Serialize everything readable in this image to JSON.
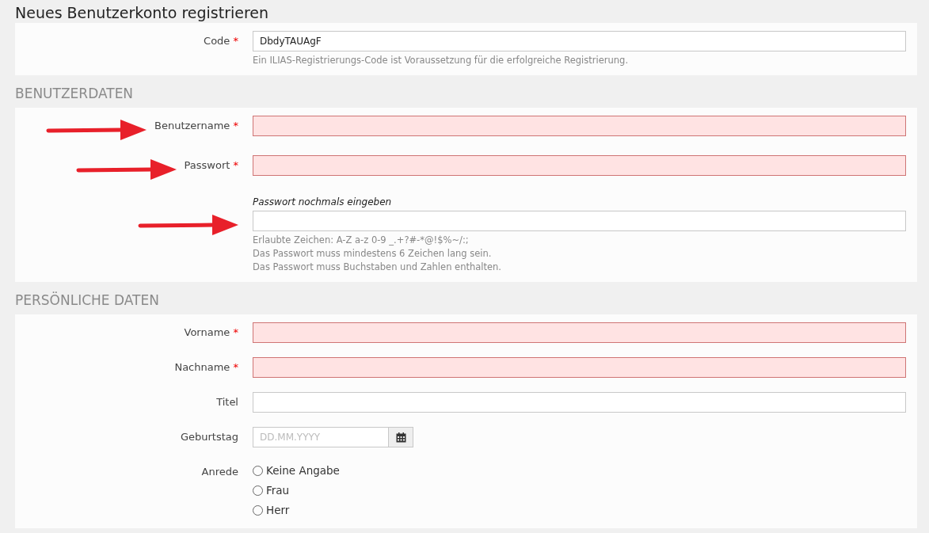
{
  "title": "Neues Benutzerkonto registrieren",
  "sections": [
    {
      "fields": [
        {
          "kind": "text",
          "label": "Code",
          "required_mark": "*",
          "invalid": false,
          "arrow": false,
          "value": "DbdyTAUAgF",
          "help": [
            "Ein ILIAS-Registrierungs-Code ist Voraussetzung für die erfolgreiche Registrierung."
          ]
        }
      ]
    },
    {
      "heading": "BENUTZERDATEN",
      "fields": [
        {
          "kind": "text",
          "label": "Benutzername",
          "required_mark": "*",
          "invalid": true,
          "arrow": true
        },
        {
          "kind": "text",
          "label": "Passwort",
          "required_mark": "*",
          "invalid": true,
          "arrow": true
        },
        {
          "kind": "text",
          "sublabel": "Passwort nochmals eingeben",
          "invalid": false,
          "arrow": true,
          "help": [
            "Erlaubte Zeichen: A-Z a-z 0-9 _.+?#-*@!$%~/:;",
            "Das Passwort muss mindestens 6 Zeichen lang sein.",
            "Das Passwort muss Buchstaben und Zahlen enthalten."
          ]
        }
      ]
    },
    {
      "heading": "PERSÖNLICHE DATEN",
      "fields": [
        {
          "kind": "text",
          "label": "Vorname",
          "required_mark": "*",
          "invalid": true,
          "arrow": false
        },
        {
          "kind": "text",
          "label": "Nachname",
          "required_mark": "*",
          "invalid": true,
          "arrow": false
        },
        {
          "kind": "text",
          "label": "Titel",
          "invalid": false,
          "arrow": false
        },
        {
          "kind": "date",
          "label": "Geburtstag",
          "invalid": false,
          "arrow": false,
          "placeholder": "DD.MM.YYYY"
        },
        {
          "kind": "radio",
          "label": "Anrede",
          "arrow": false,
          "options": [
            {
              "label": "Keine Angabe",
              "selected": false
            },
            {
              "label": "Frau",
              "selected": false
            },
            {
              "label": "Herr",
              "selected": false
            }
          ]
        }
      ]
    }
  ]
}
